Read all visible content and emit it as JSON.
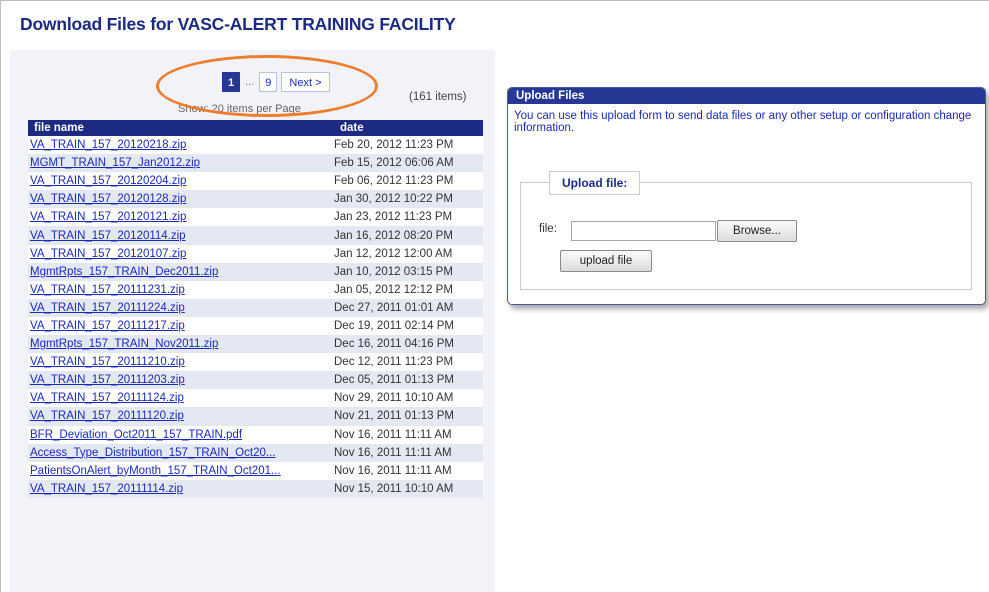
{
  "page_title": "Download Files for VASC-ALERT TRAINING FACILITY",
  "pager": {
    "current": "1",
    "dots": "...",
    "last": "9",
    "next": "Next >",
    "items_count": "(161 items)",
    "per_page": "Show: 20 items per Page"
  },
  "table": {
    "headers": [
      "file name",
      "date"
    ],
    "rows": [
      {
        "name": "VA_TRAIN_157_20120218.zip",
        "date": "Feb 20, 2012 11:23 PM"
      },
      {
        "name": "MGMT_TRAIN_157_Jan2012.zip",
        "date": "Feb 15, 2012 06:06 AM"
      },
      {
        "name": "VA_TRAIN_157_20120204.zip",
        "date": "Feb 06, 2012 11:23 PM"
      },
      {
        "name": "VA_TRAIN_157_20120128.zip",
        "date": "Jan 30, 2012 10:22 PM"
      },
      {
        "name": "VA_TRAIN_157_20120121.zip",
        "date": "Jan 23, 2012 11:23 PM"
      },
      {
        "name": "VA_TRAIN_157_20120114.zip",
        "date": "Jan 16, 2012 08:20 PM"
      },
      {
        "name": "VA_TRAIN_157_20120107.zip",
        "date": "Jan 12, 2012 12:00 AM"
      },
      {
        "name": "MgmtRpts_157_TRAIN_Dec2011.zip",
        "date": "Jan 10, 2012 03:15 PM"
      },
      {
        "name": "VA_TRAIN_157_20111231.zip",
        "date": "Jan 05, 2012 12:12 PM"
      },
      {
        "name": "VA_TRAIN_157_20111224.zip",
        "date": "Dec 27, 2011 01:01 AM"
      },
      {
        "name": "VA_TRAIN_157_20111217.zip",
        "date": "Dec 19, 2011 02:14 PM"
      },
      {
        "name": "MgmtRpts_157_TRAIN_Nov2011.zip",
        "date": "Dec 16, 2011 04:16 PM"
      },
      {
        "name": "VA_TRAIN_157_20111210.zip",
        "date": "Dec 12, 2011 11:23 PM"
      },
      {
        "name": "VA_TRAIN_157_20111203.zip",
        "date": "Dec 05, 2011 01:13 PM"
      },
      {
        "name": "VA_TRAIN_157_20111124.zip",
        "date": "Nov 29, 2011 10:10 AM"
      },
      {
        "name": "VA_TRAIN_157_20111120.zip",
        "date": "Nov 21, 2011 01:13 PM"
      },
      {
        "name": "BFR_Deviation_Oct2011_157_TRAIN.pdf",
        "date": "Nov 16, 2011 11:11 AM"
      },
      {
        "name": "Access_Type_Distribution_157_TRAIN_Oct20...",
        "date": "Nov 16, 2011 11:11 AM"
      },
      {
        "name": "PatientsOnAlert_byMonth_157_TRAIN_Oct201...",
        "date": "Nov 16, 2011 11:11 AM"
      },
      {
        "name": "VA_TRAIN_157_20111114.zip",
        "date": "Nov 15, 2011 10:10 AM"
      }
    ]
  },
  "upload": {
    "title": "Upload Files",
    "description": "You can use this upload form to send data files or any other setup or configuration change information.",
    "legend": "Upload file:",
    "file_label": "file:",
    "browse": "Browse...",
    "submit": "upload file"
  },
  "colors": {
    "navy": "#1c2a82",
    "link": "#1c2ab8",
    "highlight": "#ef7d2e",
    "row_alt": "#e4e8f3"
  }
}
